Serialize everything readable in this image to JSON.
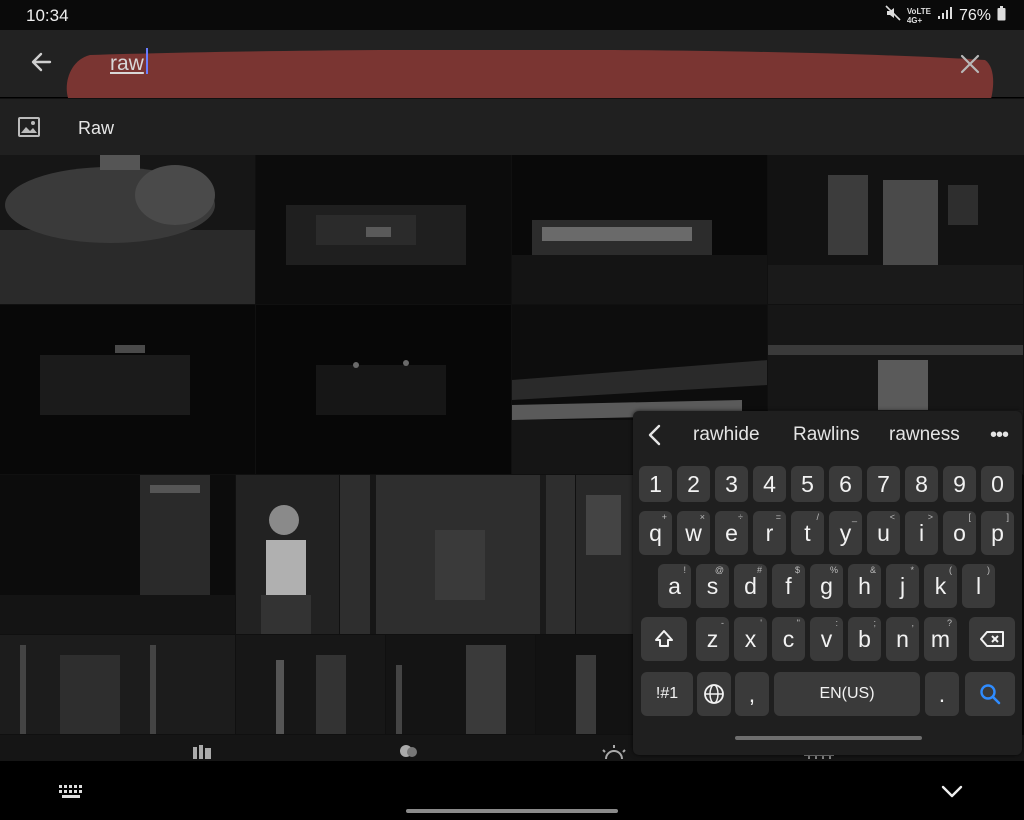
{
  "status_bar": {
    "time": "10:34",
    "battery": "76%",
    "network_badge_top": "VoLTE",
    "network_badge_bottom": "4G+",
    "icons": [
      "mute-icon",
      "signal-icon",
      "battery-icon"
    ]
  },
  "search": {
    "query": "raw",
    "highlight_color": "#7a3532"
  },
  "suggestion": {
    "label": "Raw",
    "icon": "image-icon"
  },
  "photo_grid": {
    "row_count": 4,
    "tiles": [
      {
        "content": "cat"
      },
      {
        "content": "dark-room"
      },
      {
        "content": "lit-building"
      },
      {
        "content": "windows"
      },
      {
        "content": "night-storefront"
      },
      {
        "content": "night-lights"
      },
      {
        "content": "train"
      },
      {
        "content": "street-corner"
      },
      {
        "content": "night-street"
      },
      {
        "content": "person"
      },
      {
        "content": "wall"
      },
      {
        "content": "building"
      },
      {
        "content": "trees-1"
      },
      {
        "content": "trees-2"
      },
      {
        "content": "trees-3"
      },
      {
        "content": "trees-4"
      }
    ]
  },
  "bottom_tabs": {
    "icons": [
      "library-icon",
      "people-icon",
      "brightness-icon",
      "grid-icon"
    ]
  },
  "nav_bar": {
    "icons": [
      "keyboard-toggle-icon",
      "hide-keyboard-icon"
    ]
  },
  "keyboard": {
    "predictions": [
      "rawhide",
      "Rawlins",
      "rawness"
    ],
    "more": "•••",
    "number_row": [
      "1",
      "2",
      "3",
      "4",
      "5",
      "6",
      "7",
      "8",
      "9",
      "0"
    ],
    "row1": [
      {
        "k": "q",
        "s": "+"
      },
      {
        "k": "w",
        "s": "×"
      },
      {
        "k": "e",
        "s": "÷"
      },
      {
        "k": "r",
        "s": "="
      },
      {
        "k": "t",
        "s": "/"
      },
      {
        "k": "y",
        "s": "_"
      },
      {
        "k": "u",
        "s": "<"
      },
      {
        "k": "i",
        "s": ">"
      },
      {
        "k": "o",
        "s": "["
      },
      {
        "k": "p",
        "s": "]"
      }
    ],
    "row2": [
      {
        "k": "a",
        "s": "!"
      },
      {
        "k": "s",
        "s": "@"
      },
      {
        "k": "d",
        "s": "#"
      },
      {
        "k": "f",
        "s": "$"
      },
      {
        "k": "g",
        "s": "%"
      },
      {
        "k": "h",
        "s": "&"
      },
      {
        "k": "j",
        "s": "*"
      },
      {
        "k": "k",
        "s": "("
      },
      {
        "k": "l",
        "s": ")"
      }
    ],
    "row3": [
      {
        "k": "z",
        "s": "-"
      },
      {
        "k": "x",
        "s": "'"
      },
      {
        "k": "c",
        "s": "\""
      },
      {
        "k": "v",
        "s": ":"
      },
      {
        "k": "b",
        "s": ";"
      },
      {
        "k": "n",
        "s": ","
      },
      {
        "k": "m",
        "s": "?"
      }
    ],
    "symbols_label": "!#1",
    "comma": ",",
    "space_label": "EN(US)",
    "period": ".",
    "accent_color": "#2f8cff"
  }
}
